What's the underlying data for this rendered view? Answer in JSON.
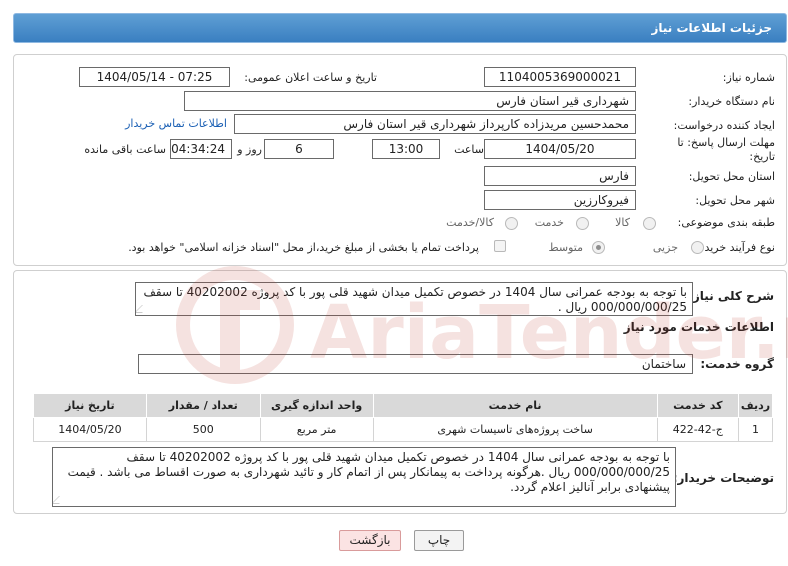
{
  "header": {
    "title": "جزئیات اطلاعات نیاز"
  },
  "form": {
    "need_number_label": "شماره نیاز:",
    "need_number": "1104005369000021",
    "announce_label": "تاریخ و ساعت اعلان عمومی:",
    "announce_value": "1404/05/14 - 07:25",
    "buyer_org_label": "نام دستگاه خریدار:",
    "buyer_org": "شهرداری قیر استان فارس",
    "creator_label": "ایجاد کننده درخواست:",
    "creator": "محمدحسین مریدزاده کارپرداز شهرداری قیر استان فارس",
    "contact_link": "اطلاعات تماس خریدار",
    "deadline_label_1": "مهلت ارسال پاسخ: تا",
    "deadline_label_2": "تاریخ:",
    "deadline_date": "1404/05/20",
    "time_label": "ساعت",
    "deadline_time": "13:00",
    "days_value": "6",
    "days_label": "روز و",
    "remaining_time": "04:34:24",
    "remaining_label": "ساعت باقی مانده",
    "province_label": "استان محل تحویل:",
    "province": "فارس",
    "city_label": "شهر محل تحویل:",
    "city": "فیروکارزین",
    "category_label": "طبقه بندی موضوعی:",
    "category_options": [
      "کالا",
      "خدمت",
      "کالا/خدمت"
    ],
    "purchase_label": "نوع فرآیند خرید :",
    "purchase_options": [
      "جزیی",
      "متوسط"
    ],
    "payment_note": "پرداخت تمام یا بخشی از مبلغ خرید،از محل \"اسناد خزانه اسلامی\" خواهد بود."
  },
  "summary": {
    "label": "شرح کلی نیاز:",
    "line1": "با توجه به بودجه عمرانی سال 1404 در خصوص تکمیل میدان شهید قلی پور با کد پروژه 40202002 تا سقف",
    "line2": "000/000/000/25 ریال ."
  },
  "services": {
    "title": "اطلاعات خدمات مورد نیاز",
    "group_label": "گروه خدمت:",
    "group_value": "ساختمان",
    "columns": [
      "ردیف",
      "کد خدمت",
      "نام خدمت",
      "واحد اندازه گیری",
      "تعداد / مقدار",
      "تاریخ نیاز"
    ],
    "rows": [
      [
        "1",
        "ج-42-422",
        "ساخت پروژه‌های تاسیسات شهری",
        "متر مربع",
        "500",
        "1404/05/20"
      ]
    ]
  },
  "buyer_notes": {
    "label": "توضیحات خریدار:",
    "line1": "با توجه به بودجه عمرانی سال 1404 در خصوص تکمیل میدان شهید قلی پور با کد پروژه 40202002 تا سقف",
    "line2": "000/000/000/25 ریال .هرگونه پرداخت به پیمانکار پس از اتمام کار و تائید شهرداری به صورت اقساط می باشد . قیمت",
    "line3": "پیشنهادی برابر آنالیز اعلام گردد."
  },
  "buttons": {
    "print": "چاپ",
    "back": "بازگشت"
  },
  "colors": {
    "header": "#3a7fc1",
    "link": "#1a5fb4",
    "watermark": "#c0392b"
  },
  "watermark": {
    "text": "AriaTender.net"
  }
}
